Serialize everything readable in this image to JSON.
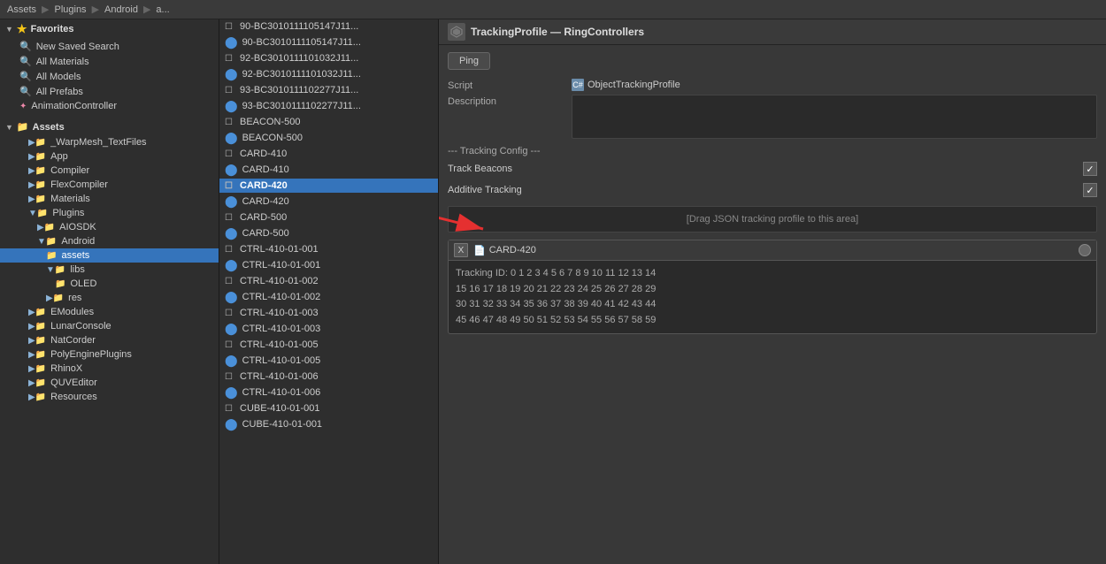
{
  "breadcrumb": {
    "parts": [
      "Assets",
      "Plugins",
      "Android",
      "a..."
    ]
  },
  "favorites": {
    "label": "Favorites",
    "items": [
      {
        "id": "new-saved-search",
        "label": "New Saved Search",
        "type": "search"
      },
      {
        "id": "all-materials",
        "label": "All Materials",
        "type": "search"
      },
      {
        "id": "all-models",
        "label": "All Models",
        "type": "search"
      },
      {
        "id": "all-prefabs",
        "label": "All Prefabs",
        "type": "search"
      },
      {
        "id": "anim-controller",
        "label": "AnimationController",
        "type": "anim"
      }
    ]
  },
  "assets_tree": {
    "label": "Assets",
    "items": [
      {
        "id": "warp",
        "label": "_WarpMesh_TextFiles",
        "depth": 1
      },
      {
        "id": "app",
        "label": "App",
        "depth": 1
      },
      {
        "id": "compiler",
        "label": "Compiler",
        "depth": 1
      },
      {
        "id": "flex",
        "label": "FlexCompiler",
        "depth": 1
      },
      {
        "id": "materials",
        "label": "Materials",
        "depth": 1
      },
      {
        "id": "plugins",
        "label": "Plugins",
        "depth": 1,
        "expanded": true
      },
      {
        "id": "aiosdk",
        "label": "AIOSDK",
        "depth": 2
      },
      {
        "id": "android",
        "label": "Android",
        "depth": 2,
        "expanded": true
      },
      {
        "id": "assets",
        "label": "assets",
        "depth": 3,
        "selected": true
      },
      {
        "id": "libs",
        "label": "libs",
        "depth": 3,
        "expanded": true
      },
      {
        "id": "oled",
        "label": "OLED",
        "depth": 4
      },
      {
        "id": "res",
        "label": "res",
        "depth": 3
      },
      {
        "id": "emodules",
        "label": "EModules",
        "depth": 1
      },
      {
        "id": "lunar",
        "label": "LunarConsole",
        "depth": 1
      },
      {
        "id": "natcorder",
        "label": "NatCorder",
        "depth": 1
      },
      {
        "id": "polyengine",
        "label": "PolyEnginePlugins",
        "depth": 1
      },
      {
        "id": "rhinox",
        "label": "RhinoX",
        "depth": 1
      },
      {
        "id": "quvEditor",
        "label": "QUVEditor",
        "depth": 0
      },
      {
        "id": "resources",
        "label": "Resources",
        "depth": 0
      }
    ]
  },
  "asset_list": [
    {
      "id": "f1",
      "name": "90-BC3010111105147J11...",
      "hasCircle": false
    },
    {
      "id": "f2",
      "name": "90-BC3010111105147J11...",
      "hasCircle": true
    },
    {
      "id": "f3",
      "name": "92-BC3010111101032J11...",
      "hasCircle": false
    },
    {
      "id": "f4",
      "name": "92-BC3010111101032J11...",
      "hasCircle": true
    },
    {
      "id": "f5",
      "name": "93-BC3010111102277J11...",
      "hasCircle": false
    },
    {
      "id": "f6",
      "name": "93-BC3010111102277J11...",
      "hasCircle": true
    },
    {
      "id": "f7",
      "name": "BEACON-500",
      "hasCircle": false
    },
    {
      "id": "f8",
      "name": "BEACON-500",
      "hasCircle": true
    },
    {
      "id": "f9",
      "name": "CARD-410",
      "hasCircle": false
    },
    {
      "id": "f10",
      "name": "CARD-410",
      "hasCircle": true
    },
    {
      "id": "f11",
      "name": "CARD-420",
      "hasCircle": false,
      "selected": true
    },
    {
      "id": "f12",
      "name": "CARD-420",
      "hasCircle": true
    },
    {
      "id": "f13",
      "name": "CARD-500",
      "hasCircle": false
    },
    {
      "id": "f14",
      "name": "CARD-500",
      "hasCircle": true
    },
    {
      "id": "f15",
      "name": "CTRL-410-01-001",
      "hasCircle": false
    },
    {
      "id": "f16",
      "name": "CTRL-410-01-001",
      "hasCircle": true
    },
    {
      "id": "f17",
      "name": "CTRL-410-01-002",
      "hasCircle": false
    },
    {
      "id": "f18",
      "name": "CTRL-410-01-002",
      "hasCircle": true
    },
    {
      "id": "f19",
      "name": "CTRL-410-01-003",
      "hasCircle": false
    },
    {
      "id": "f20",
      "name": "CTRL-410-01-003",
      "hasCircle": true
    },
    {
      "id": "f21",
      "name": "CTRL-410-01-005",
      "hasCircle": false
    },
    {
      "id": "f22",
      "name": "CTRL-410-01-005",
      "hasCircle": true
    },
    {
      "id": "f23",
      "name": "CTRL-410-01-006",
      "hasCircle": false
    },
    {
      "id": "f24",
      "name": "CTRL-410-01-006",
      "hasCircle": true
    },
    {
      "id": "f25",
      "name": "CUBE-410-01-001",
      "hasCircle": false
    },
    {
      "id": "f26",
      "name": "CUBE-410-01-001",
      "hasCircle": true
    }
  ],
  "inspector": {
    "title": "TrackingProfile — RingControllers",
    "ping_label": "Ping",
    "script_label": "Script",
    "script_value": "ObjectTrackingProfile",
    "description_label": "Description",
    "tracking_config_divider": "--- Tracking Config ---",
    "track_beacons_label": "Track Beacons",
    "track_beacons_checked": true,
    "additive_tracking_label": "Additive Tracking",
    "additive_tracking_checked": true,
    "drag_area_label": "[Drag JSON tracking profile to this area]",
    "card_name": "CARD-420",
    "tracking_id_label": "Tracking ID:",
    "tracking_id_values": "0 1 2 3 4 5 6 7 8 9 10 11 12 13 14",
    "tracking_id_row2": "15 16 17 18 19 20 21 22 23 24 25 26 27 28 29",
    "tracking_id_row3": "30 31 32 33 34 35 36 37 38 39 40 41 42 43 44",
    "tracking_id_row4": "45 46 47 48 49 50 51 52 53 54 55 56 57 58 59"
  }
}
